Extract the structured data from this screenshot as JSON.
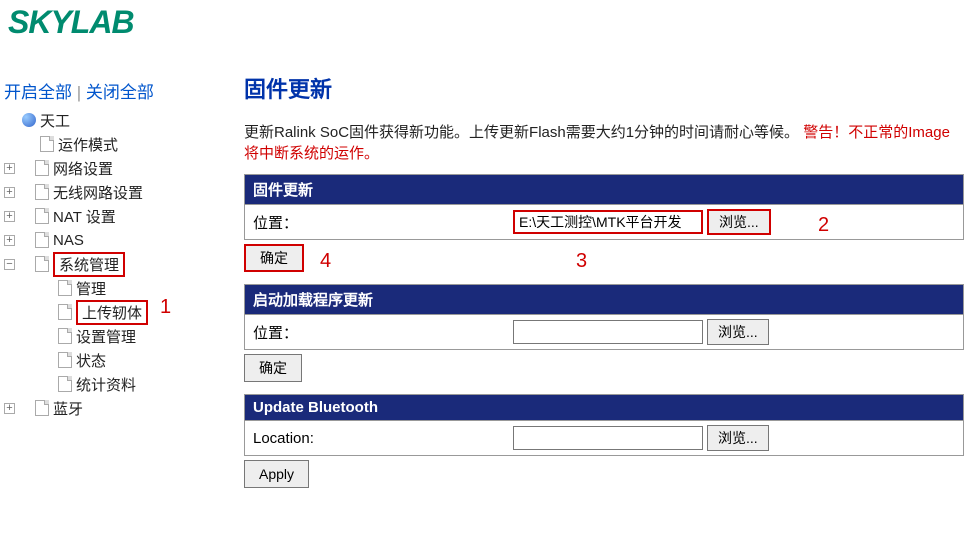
{
  "logo": "SKYLAB",
  "top_links": {
    "open_all": "开启全部",
    "close_all": "关闭全部",
    "sep": " | "
  },
  "tree": {
    "root": "天工",
    "items": [
      "运作模式",
      "网络设置",
      "无线网路设置",
      "NAT 设置",
      "NAS",
      "系统管理",
      "管理",
      "上传轫体",
      "设置管理",
      "状态",
      "统计资料",
      "蓝牙"
    ]
  },
  "main": {
    "title": "固件更新",
    "desc_part1": "更新Ralink SoC固件获得新功能。上传更新Flash需要大约1分钟的时间请耐心等候。",
    "desc_warn": "警告！不正常的Image将中断系统的运作。",
    "sections": [
      {
        "header": "固件更新",
        "row_label": "位置：",
        "input_value": "E:\\天工测控\\MTK平台开发",
        "browse": "浏览...",
        "submit": "确定"
      },
      {
        "header": "启动加载程序更新",
        "row_label": "位置：",
        "input_value": "",
        "browse": "浏览...",
        "submit": "确定"
      },
      {
        "header": "Update Bluetooth",
        "row_label": "Location:",
        "input_value": "",
        "browse": "浏览...",
        "submit": "Apply"
      }
    ]
  },
  "annotations": {
    "a1": "1",
    "a2": "2",
    "a3": "3",
    "a4": "4"
  }
}
